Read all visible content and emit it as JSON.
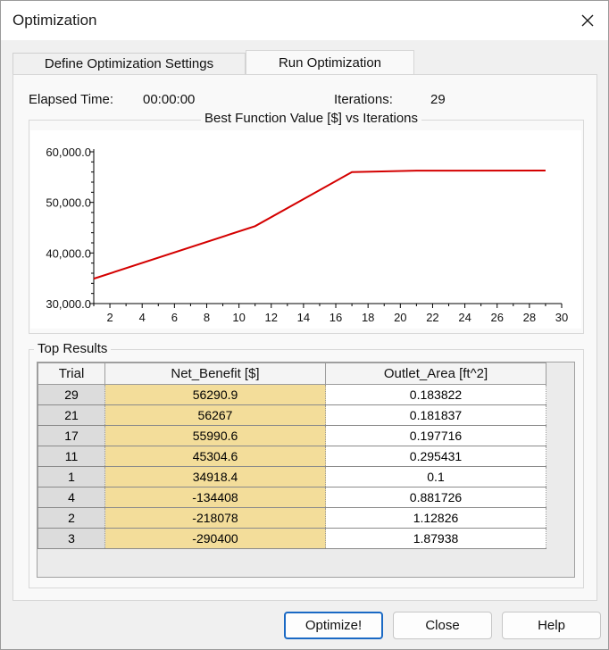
{
  "window": {
    "title": "Optimization"
  },
  "tabs": [
    {
      "label": "Define Optimization Settings",
      "active": false
    },
    {
      "label": "Run Optimization",
      "active": true
    }
  ],
  "status": {
    "elapsed_label": "Elapsed Time:",
    "elapsed_value": "00:00:00",
    "iterations_label": "Iterations:",
    "iterations_value": "29"
  },
  "chart_group_title": "Best Function Value [$] vs Iterations",
  "chart_data": {
    "type": "line",
    "title": "Best Function Value [$] vs Iterations",
    "xlim": [
      1,
      30
    ],
    "ylim": [
      30000,
      60000
    ],
    "x_ticks": [
      "2",
      "4",
      "6",
      "8",
      "10",
      "12",
      "14",
      "16",
      "18",
      "20",
      "22",
      "24",
      "26",
      "28",
      "30"
    ],
    "y_ticks": [
      "30,000.0",
      "40,000.0",
      "50,000.0",
      "60,000.0"
    ],
    "series": [
      {
        "color": "#d40000",
        "x": [
          1,
          11,
          17,
          21,
          29
        ],
        "y": [
          34918.4,
          45304.6,
          55990.6,
          56267,
          56290.9
        ]
      }
    ],
    "grid": false
  },
  "results": {
    "group_title": "Top Results",
    "columns": [
      "Trial",
      "Net_Benefit [$]",
      "Outlet_Area [ft^2]"
    ],
    "rows": [
      [
        "29",
        "56290.9",
        "0.183822"
      ],
      [
        "21",
        "56267",
        "0.181837"
      ],
      [
        "17",
        "55990.6",
        "0.197716"
      ],
      [
        "11",
        "45304.6",
        "0.295431"
      ],
      [
        "1",
        "34918.4",
        "0.1"
      ],
      [
        "4",
        "-134408",
        "0.881726"
      ],
      [
        "2",
        "-218078",
        "1.12826"
      ],
      [
        "3",
        "-290400",
        "1.87938"
      ]
    ]
  },
  "buttons": {
    "optimize": "Optimize!",
    "close": "Close",
    "help": "Help"
  },
  "colors": {
    "line": "#d40000",
    "highlight_column": "#f3dd9a",
    "primary_border": "#1a69c4"
  }
}
